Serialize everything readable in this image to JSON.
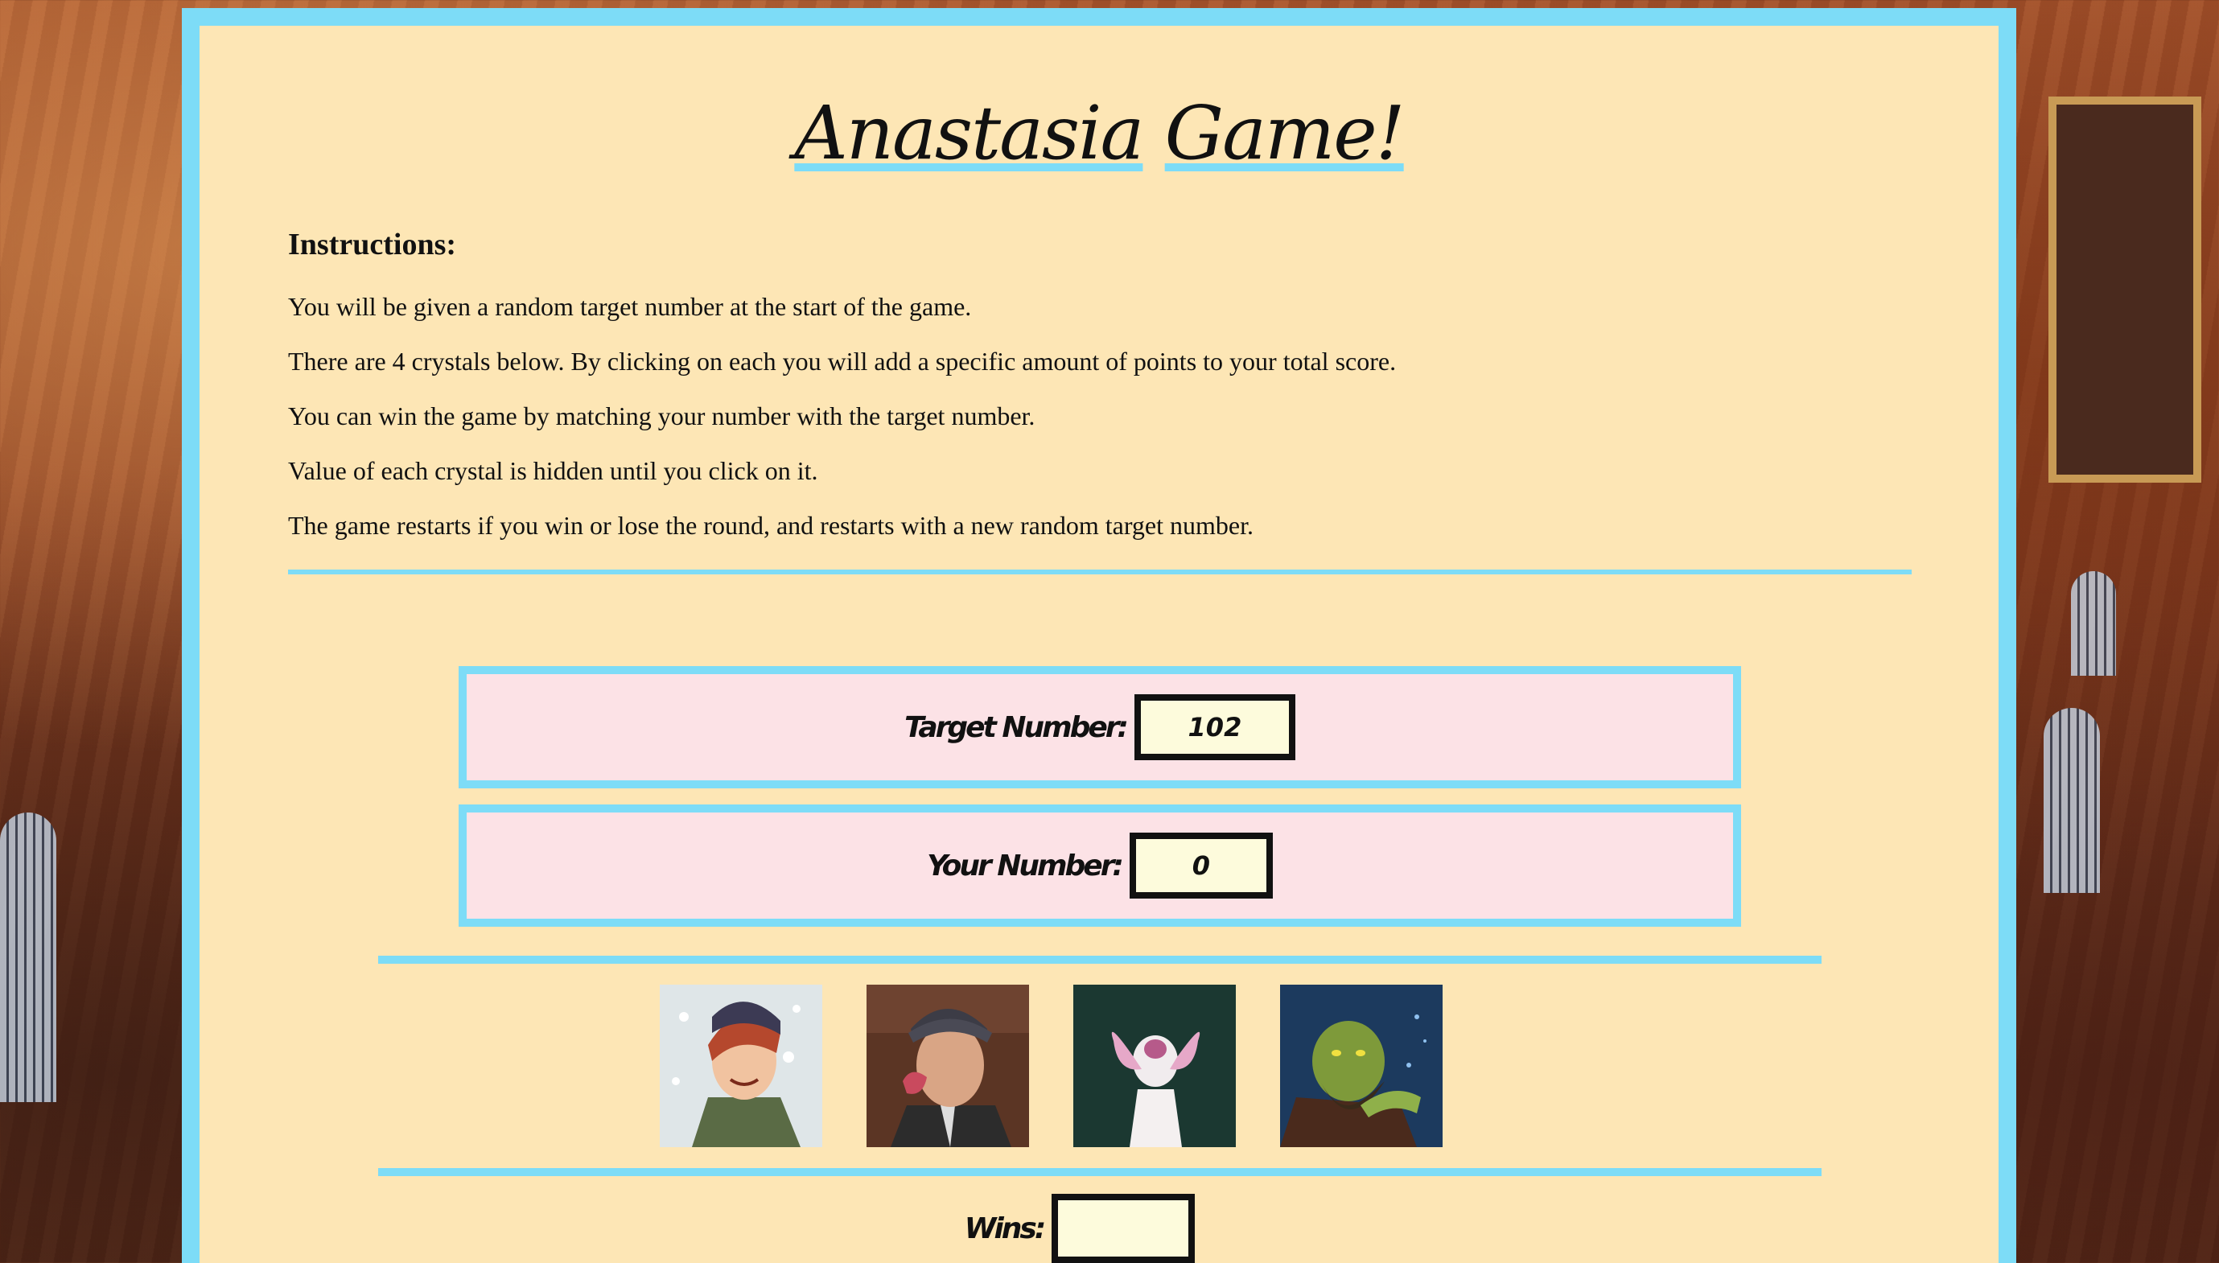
{
  "title": {
    "word1": "Anastasia",
    "word2": "Game!"
  },
  "instructions": {
    "heading": "Instructions:",
    "lines": [
      "You will be given a random target number at the start of the game.",
      "There are 4 crystals below. By clicking on each you will add a specific amount of points to your total score.",
      "You can win the game by matching your number with the target number.",
      "Value of each crystal is hidden until you click on it.",
      "The game restarts if you win or lose the round, and restarts with a new random target number."
    ]
  },
  "target": {
    "label": "Target Number:",
    "value": "102"
  },
  "your_number": {
    "label": "Your Number:",
    "value": "0"
  },
  "crystals": [
    {
      "icon": "anastasia-crystal-icon"
    },
    {
      "icon": "dimitri-crystal-icon"
    },
    {
      "icon": "bartok-crystal-icon"
    },
    {
      "icon": "rasputin-crystal-icon"
    }
  ],
  "wins": {
    "label": "Wins:",
    "value": ""
  },
  "colors": {
    "accent": "#7ddcf7",
    "panel": "#fde6b5",
    "number_box": "#fce2e6",
    "value_box": "#fdfbdc"
  }
}
